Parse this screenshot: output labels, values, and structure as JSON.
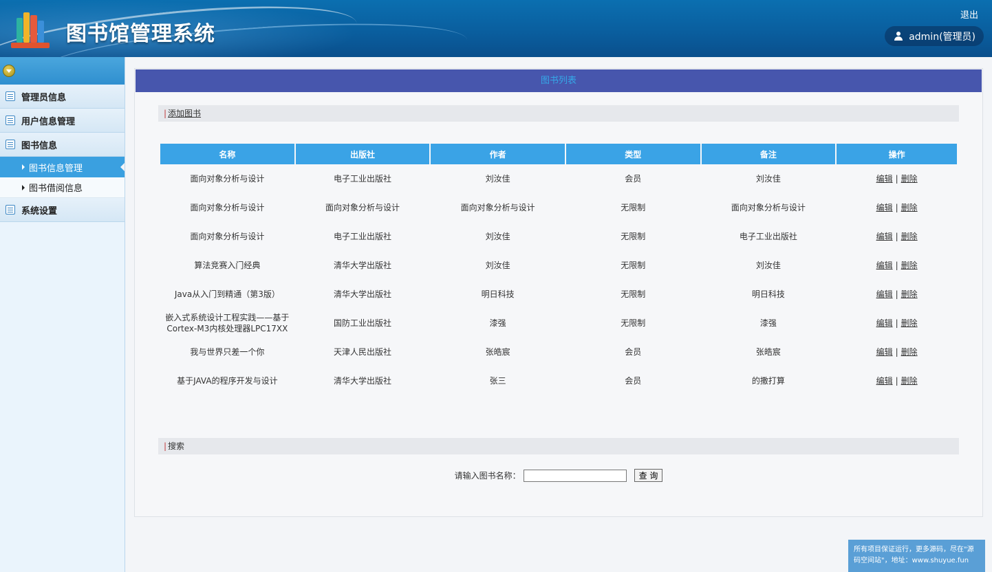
{
  "header": {
    "title": "图书馆管理系统",
    "logout_label": "退出",
    "user_label": "admin(管理员)"
  },
  "sidebar": {
    "items": [
      {
        "label": "管理员信息"
      },
      {
        "label": "用户信息管理"
      },
      {
        "label": "图书信息"
      }
    ],
    "sub_items": [
      {
        "label": "图书信息管理",
        "active": true
      },
      {
        "label": "图书借阅信息",
        "active": false
      }
    ],
    "last_item": {
      "label": "系统设置"
    }
  },
  "panel": {
    "title": "图书列表",
    "add_link": "添加图书",
    "columns": [
      "名称",
      "出版社",
      "作者",
      "类型",
      "备注",
      "操作"
    ],
    "rows": [
      {
        "name": "面向对象分析与设计",
        "publisher": "电子工业出版社",
        "author": "刘汝佳",
        "type": "会员",
        "remark": "刘汝佳"
      },
      {
        "name": "面向对象分析与设计",
        "publisher": "面向对象分析与设计",
        "author": "面向对象分析与设计",
        "type": "无限制",
        "remark": "面向对象分析与设计"
      },
      {
        "name": "面向对象分析与设计",
        "publisher": "电子工业出版社",
        "author": "刘汝佳",
        "type": "无限制",
        "remark": "电子工业出版社"
      },
      {
        "name": "算法竞赛入门经典",
        "publisher": "清华大学出版社",
        "author": "刘汝佳",
        "type": "无限制",
        "remark": "刘汝佳"
      },
      {
        "name": "Java从入门到精通（第3版）",
        "publisher": "清华大学出版社",
        "author": "明日科技",
        "type": "无限制",
        "remark": "明日科技"
      },
      {
        "name": "嵌入式系统设计工程实践——基于Cortex-M3内核处理器LPC17XX",
        "publisher": "国防工业出版社",
        "author": "漆强",
        "type": "无限制",
        "remark": "漆强"
      },
      {
        "name": "我与世界只差一个你",
        "publisher": "天津人民出版社",
        "author": "张皓宸",
        "type": "会员",
        "remark": "张皓宸"
      },
      {
        "name": "基于JAVA的程序开发与设计",
        "publisher": "清华大学出版社",
        "author": "张三",
        "type": "会员",
        "remark": "的撒打算"
      }
    ],
    "edit_label": "编辑",
    "delete_label": "删除",
    "search_section": "搜索",
    "search_label": "请输入图书名称：",
    "search_value": "",
    "search_button": "查 询"
  },
  "footer_note": "所有项目保证运行，更多源码，尽在\"源码空间站\"，地址：www.shuyue.fun"
}
